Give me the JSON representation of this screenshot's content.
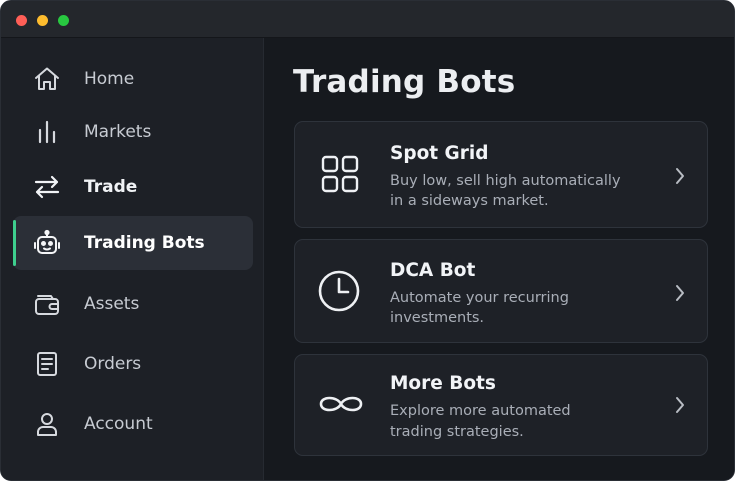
{
  "sidebar": {
    "items": [
      {
        "label": "Home",
        "icon": "home-icon"
      },
      {
        "label": "Markets",
        "icon": "bar-chart-icon"
      },
      {
        "label": "Trade",
        "icon": "swap-arrows-icon"
      },
      {
        "label": "Trading Bots",
        "icon": "robot-icon",
        "active": true
      },
      {
        "label": "Assets",
        "icon": "wallet-icon"
      },
      {
        "label": "Orders",
        "icon": "document-icon"
      },
      {
        "label": "Account",
        "icon": "user-icon"
      }
    ]
  },
  "main": {
    "title": "Trading Bots",
    "cards": [
      {
        "title": "Spot Grid",
        "desc_line1": "Buy low, sell high automatically",
        "desc_line2": "in a sideways market.",
        "icon": "grid-icon"
      },
      {
        "title": "DCA Bot",
        "desc_line1": "Automate your recurring",
        "desc_line2": "investments.",
        "icon": "clock-icon"
      },
      {
        "title": "More Bots",
        "desc_line1": "Explore more automated",
        "desc_line2": "trading strategies.",
        "icon": "infinity-icon"
      }
    ]
  },
  "colors": {
    "accent": "#3ecf8e",
    "window_bg": "#16191e",
    "sidebar_bg": "#1d2026",
    "card_bg": "#1e2127"
  }
}
